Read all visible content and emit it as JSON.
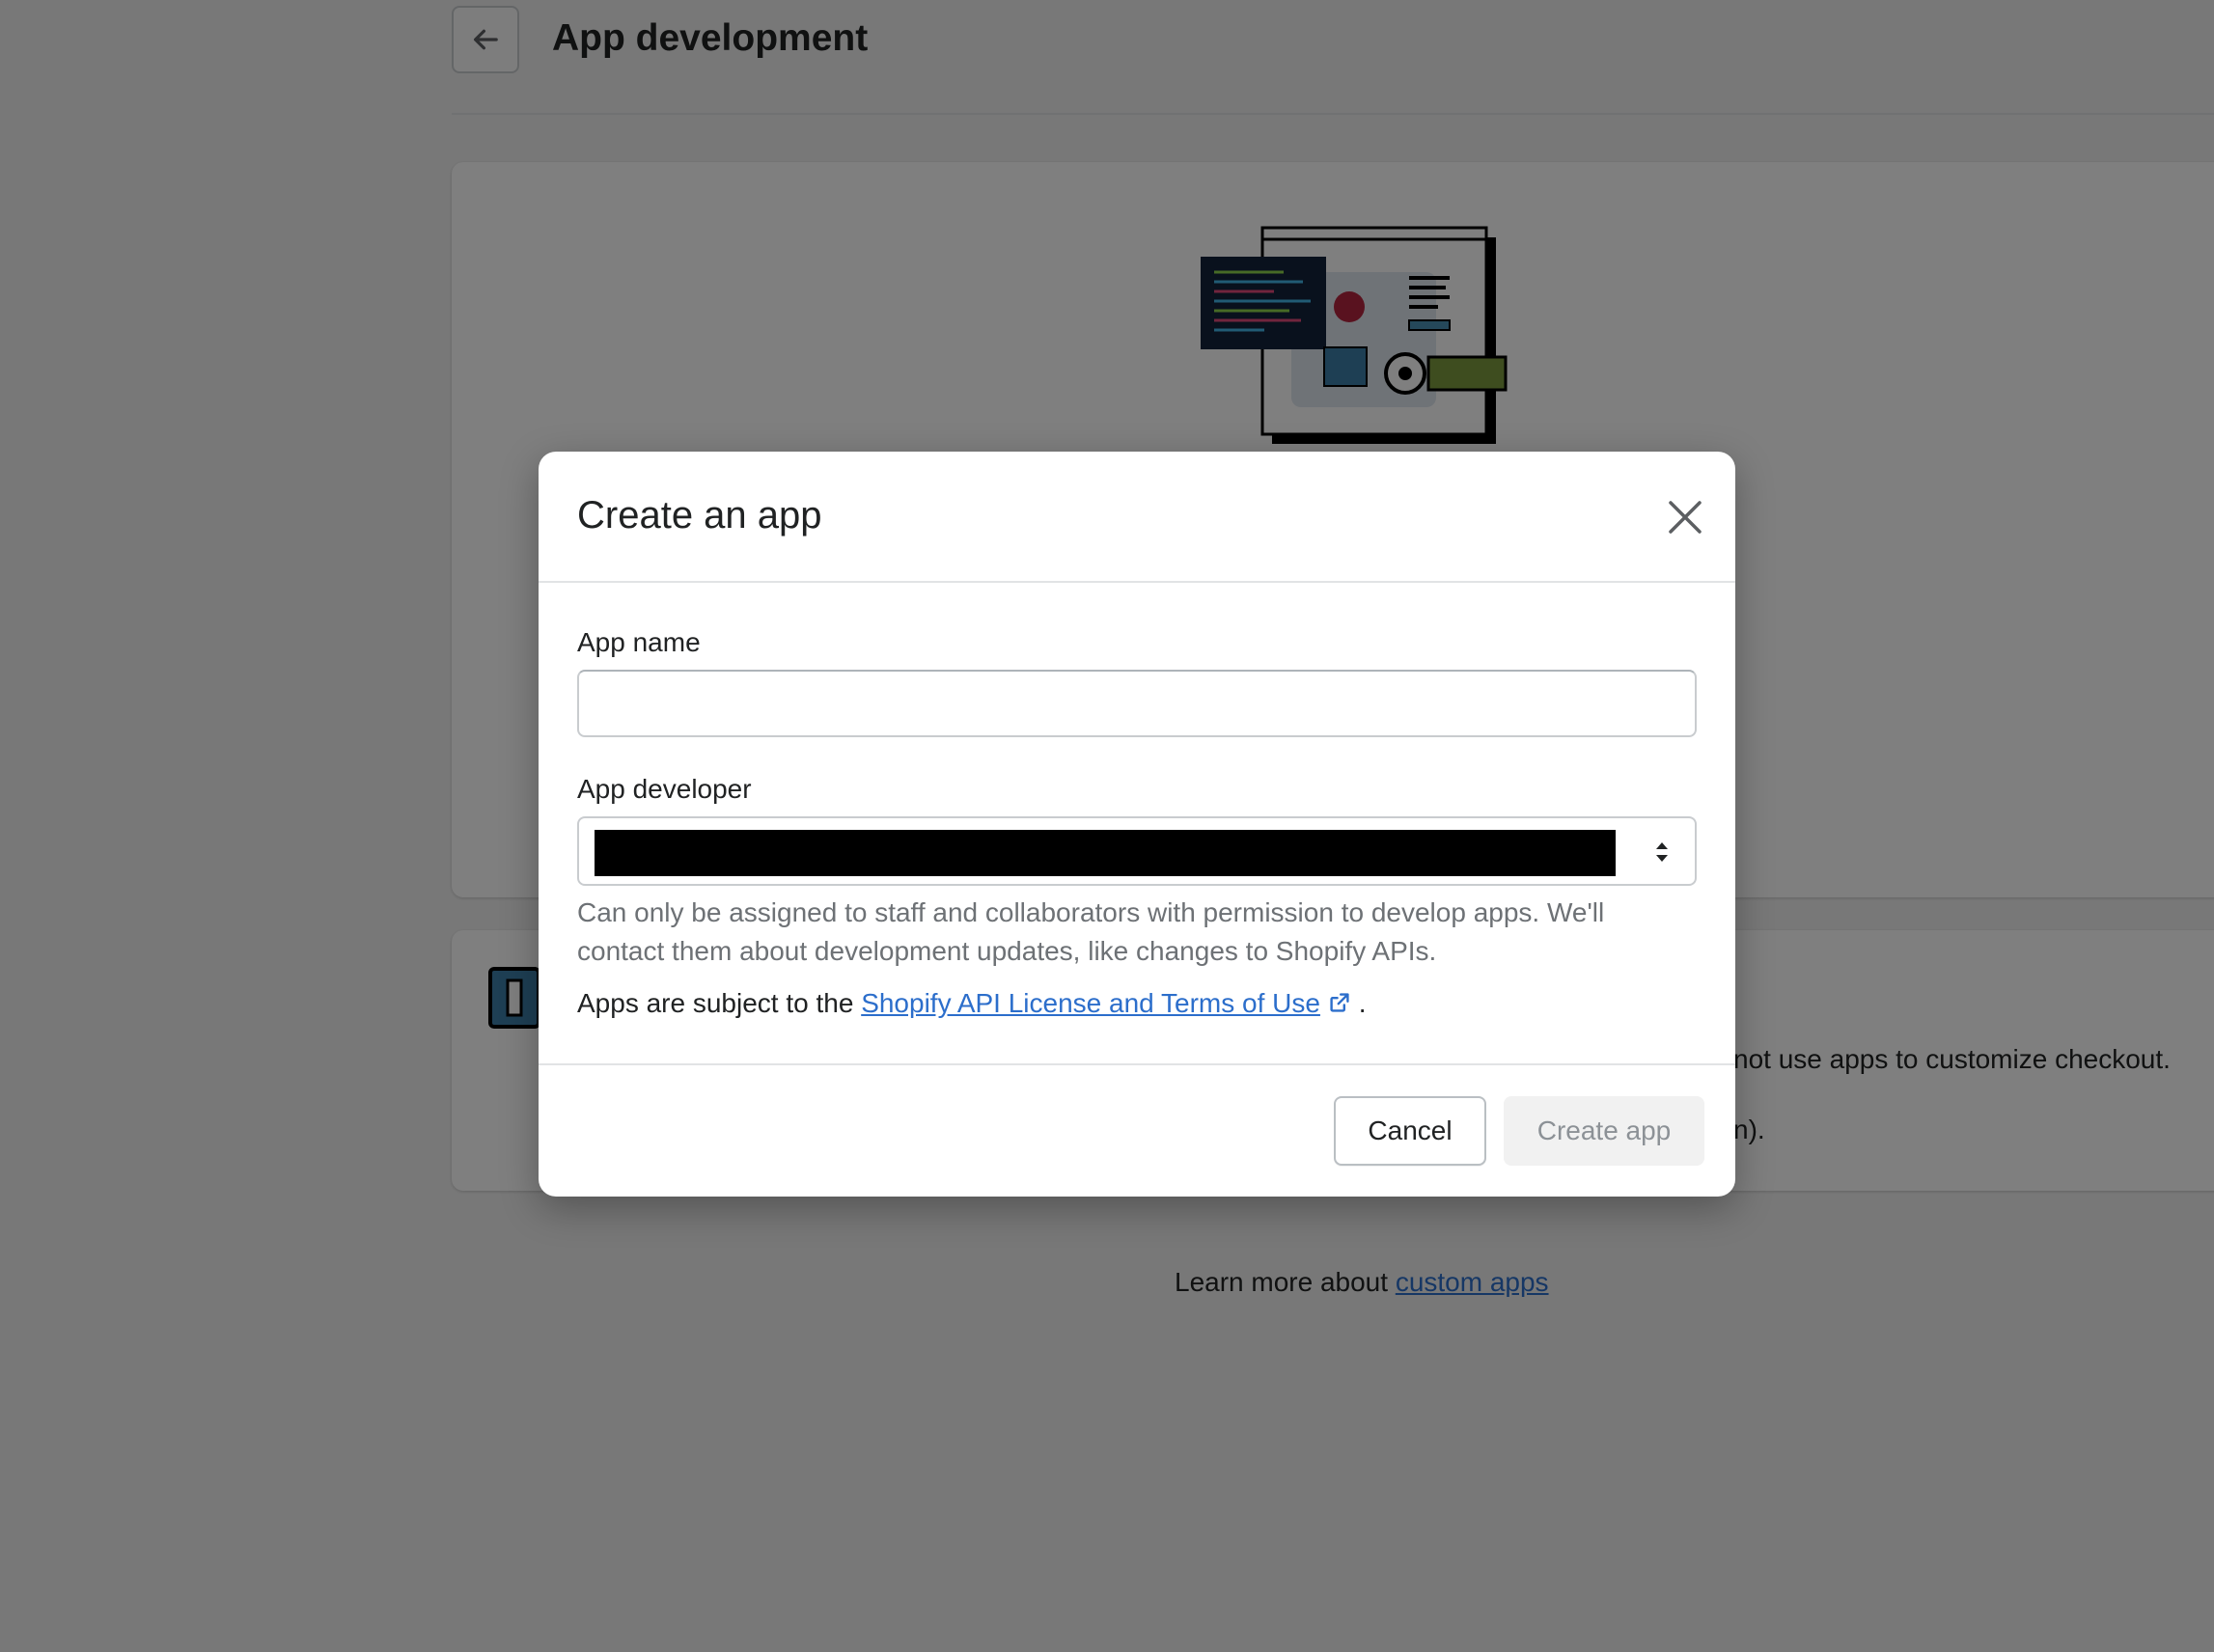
{
  "page": {
    "title": "App development",
    "back_icon": "arrow-left-icon",
    "card2_text": "not use apps to customize checkout.",
    "card2_sub": "n).",
    "learn_more_prefix": "Learn more about ",
    "learn_more_link": "custom apps"
  },
  "modal": {
    "title": "Create an app",
    "close_icon": "close-icon",
    "app_name_label": "App name",
    "app_name_value": "",
    "app_developer_label": "App developer",
    "app_developer_value": "",
    "help_text": "Can only be assigned to staff and collaborators with permission to develop apps. We'll contact them about development updates, like changes to Shopify APIs.",
    "terms_prefix": "Apps are subject to the ",
    "terms_link": "Shopify API License and Terms of Use",
    "terms_suffix": " .",
    "cancel_label": "Cancel",
    "create_label": "Create app"
  },
  "colors": {
    "link": "#2c6ecb",
    "overlay": "rgba(0,0,0,0.5)",
    "disabled_button_bg": "#f1f1f1"
  }
}
